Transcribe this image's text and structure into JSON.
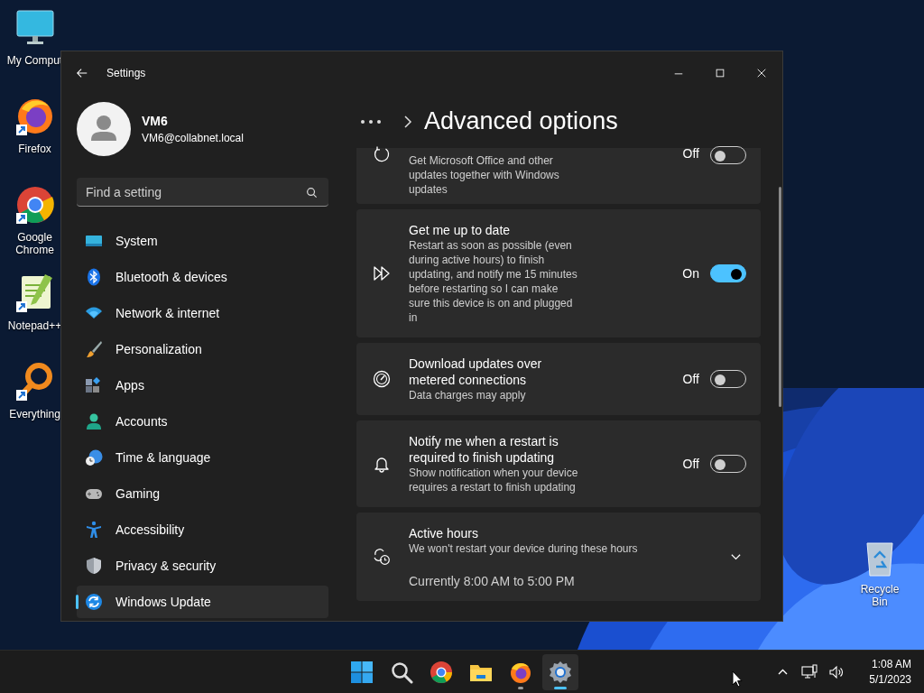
{
  "desktop": {
    "icons": [
      {
        "label": "My Comput"
      },
      {
        "label": "Firefox"
      },
      {
        "label": "Google Chrome"
      },
      {
        "label": "Notepad++"
      },
      {
        "label": "Everything"
      }
    ],
    "recycle_bin": {
      "label": "Recycle Bin"
    }
  },
  "window": {
    "title": "Settings",
    "profile": {
      "name": "VM6",
      "email": "VM6@collabnet.local"
    },
    "search": {
      "placeholder": "Find a setting"
    },
    "sidebar": {
      "items": [
        {
          "label": "System",
          "selected": false
        },
        {
          "label": "Bluetooth & devices",
          "selected": false
        },
        {
          "label": "Network & internet",
          "selected": false
        },
        {
          "label": "Personalization",
          "selected": false
        },
        {
          "label": "Apps",
          "selected": false
        },
        {
          "label": "Accounts",
          "selected": false
        },
        {
          "label": "Time & language",
          "selected": false
        },
        {
          "label": "Gaming",
          "selected": false
        },
        {
          "label": "Accessibility",
          "selected": false
        },
        {
          "label": "Privacy & security",
          "selected": false
        },
        {
          "label": "Windows Update",
          "selected": true
        }
      ]
    },
    "page_title": "Advanced options",
    "settings": [
      {
        "kind": "toggle",
        "description": "Get Microsoft Office and other updates together with Windows updates",
        "state_label": "Off",
        "on": false
      },
      {
        "kind": "toggle",
        "title": "Get me up to date",
        "description": "Restart as soon as possible (even during active hours) to finish updating, and notify me 15 minutes before restarting so I can make sure this device is on and plugged in",
        "state_label": "On",
        "on": true
      },
      {
        "kind": "toggle",
        "title": "Download updates over metered connections",
        "description": "Data charges may apply",
        "state_label": "Off",
        "on": false
      },
      {
        "kind": "toggle",
        "title": "Notify me when a restart is required to finish updating",
        "description": "Show notification when your device requires a restart to finish updating",
        "state_label": "Off",
        "on": false
      },
      {
        "kind": "expander",
        "title": "Active hours",
        "description": "We won't restart your device during these hours",
        "value": "Currently 8:00 AM to 5:00 PM",
        "expanded": false
      }
    ]
  },
  "taskbar": {
    "apps": [
      {
        "running": false,
        "active": false
      },
      {
        "running": false,
        "active": false
      },
      {
        "running": false,
        "active": false
      },
      {
        "running": false,
        "active": false
      },
      {
        "running": true,
        "active": false
      },
      {
        "running": true,
        "active": true
      }
    ],
    "clock": {
      "time": "1:08 AM",
      "date": "5/1/2023"
    }
  }
}
